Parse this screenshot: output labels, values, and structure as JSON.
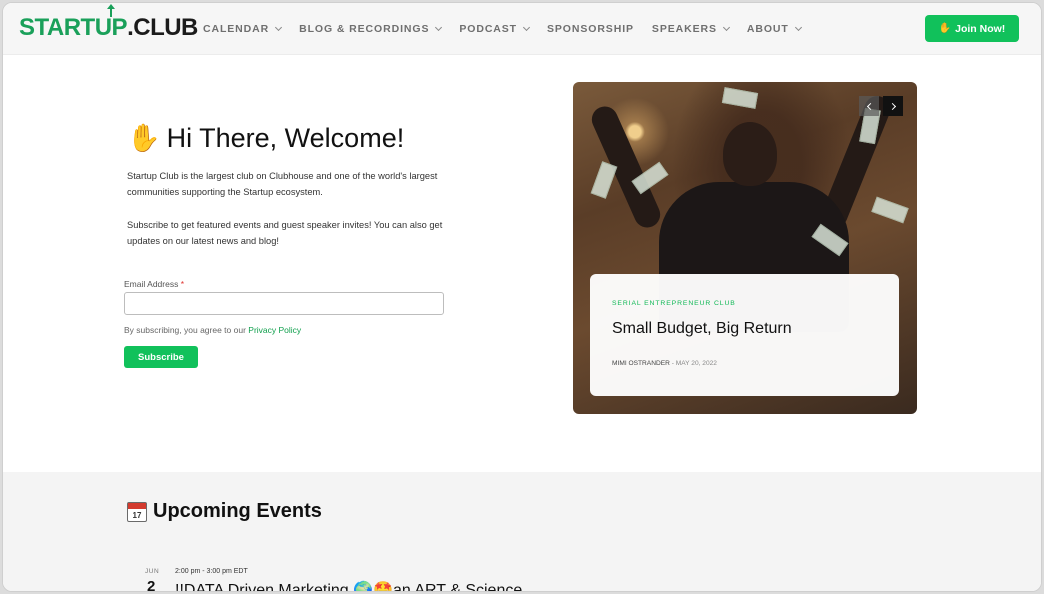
{
  "header": {
    "logo_left": "START",
    "logo_up": "UP",
    "logo_right": ".CLUB",
    "nav": [
      {
        "label": "CALENDAR",
        "has_dropdown": true
      },
      {
        "label": "BLOG & RECORDINGS",
        "has_dropdown": true
      },
      {
        "label": "PODCAST",
        "has_dropdown": true
      },
      {
        "label": "SPONSORSHIP",
        "has_dropdown": false
      },
      {
        "label": "SPEAKERS",
        "has_dropdown": true
      },
      {
        "label": "ABOUT",
        "has_dropdown": true
      }
    ],
    "join_label": "Join Now!",
    "join_icon": "waving-hand-icon"
  },
  "hero": {
    "title": "Hi There, Welcome!",
    "title_icon": "waving-hand-icon",
    "intro": "Startup Club is the largest club on Clubhouse and one of the world's largest communities supporting the Startup ecosystem.",
    "subscribe_text": "Subscribe to get featured events and guest speaker invites! You can also get updates on our latest news and blog!",
    "form": {
      "email_label": "Email Address",
      "required_mark": "*",
      "email_value": "",
      "consent_prefix": "By subscribing, you agree to our",
      "privacy_link": "Privacy Policy",
      "subscribe_label": "Subscribe"
    }
  },
  "featured_post": {
    "category": "SERIAL ENTREPRENEUR CLUB",
    "title": "Small Budget, Big Return",
    "author": "MIMI OSTRANDER",
    "separator": "-",
    "date": "MAY 20, 2022"
  },
  "events": {
    "heading": "Upcoming Events",
    "heading_icon": "calendar-icon",
    "calendar_icon_day": "17",
    "items": [
      {
        "month": "JUN",
        "day": "2",
        "time": "2:00 pm - 3:00 pm EDT",
        "title_before": "!!DATA Driven Marketing",
        "title_after": "an ART & Science"
      }
    ]
  },
  "colors": {
    "brand_green": "#11c15b",
    "accent_green_text": "#12b957",
    "header_bg": "#f6f6f6",
    "events_bg": "#f4f4f4"
  }
}
